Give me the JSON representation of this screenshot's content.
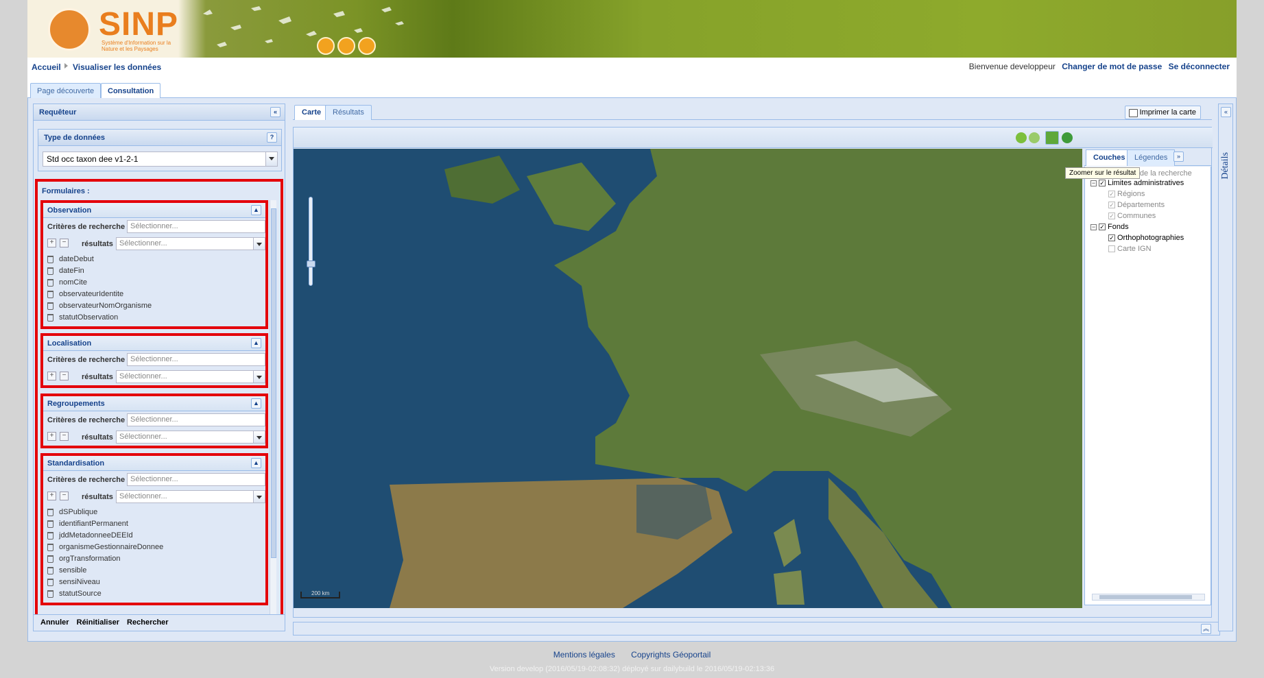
{
  "banner": {
    "brand": "SINP",
    "brand_sub": "Système d'Information sur la Nature et les Paysages"
  },
  "breadcrumb": {
    "home": "Accueil",
    "current": "Visualiser les données"
  },
  "user": {
    "welcome": "Bienvenue developpeur",
    "change_password": "Changer de mot de passe",
    "logout": "Se déconnecter"
  },
  "page_tabs": [
    "Page découverte",
    "Consultation"
  ],
  "requeteur": {
    "title": "Requêteur",
    "type_title": "Type de données",
    "type_help": "?",
    "type_value": "Std occ taxon dee v1-2-1",
    "forms_title": "Formulaires :",
    "crit_label": "Critères de recherche",
    "res_label": "résultats",
    "placeholder": "Sélectionner...",
    "fieldsets": [
      {
        "title": "Observation",
        "items": [
          "dateDebut",
          "dateFin",
          "nomCite",
          "observateurIdentite",
          "observateurNomOrganisme",
          "statutObservation"
        ]
      },
      {
        "title": "Localisation",
        "items": []
      },
      {
        "title": "Regroupements",
        "items": []
      },
      {
        "title": "Standardisation",
        "items": [
          "dSPublique",
          "identifiantPermanent",
          "jddMetadonneeDEEId",
          "organismeGestionnaireDonnee",
          "orgTransformation",
          "sensible",
          "sensiNiveau",
          "statutSource"
        ]
      }
    ],
    "actions": {
      "cancel": "Annuler",
      "reset": "Réinitialiser",
      "search": "Rechercher"
    }
  },
  "center": {
    "tabs": [
      "Carte",
      "Résultats"
    ],
    "print": "Imprimer la carte",
    "scale_bar": "200 km"
  },
  "layers": {
    "tabs": [
      "Couches",
      "Légendes"
    ],
    "tooltip": "Zoomer sur le résultat",
    "tree": [
      {
        "label": "Résultats de la recherche",
        "checked": false,
        "dim": true
      },
      {
        "label": "Limites administratives",
        "checked": true,
        "dim": false
      },
      {
        "label": "Régions",
        "checked": true,
        "dim": true
      },
      {
        "label": "Départements",
        "checked": true,
        "dim": true
      },
      {
        "label": "Communes",
        "checked": true,
        "dim": true
      },
      {
        "label": "Fonds",
        "checked": true,
        "dim": false
      },
      {
        "label": "Orthophotographies",
        "checked": true,
        "dim": false
      },
      {
        "label": "Carte IGN",
        "checked": false,
        "dim": true
      }
    ]
  },
  "details": {
    "label": "Détails"
  },
  "footer": {
    "legal": "Mentions légales",
    "copyright": "Copyrights Géoportail",
    "version": "Version develop (2016/05/19-02:08:32) déployé sur dailybuild le 2016/05/19-02:13:36"
  }
}
